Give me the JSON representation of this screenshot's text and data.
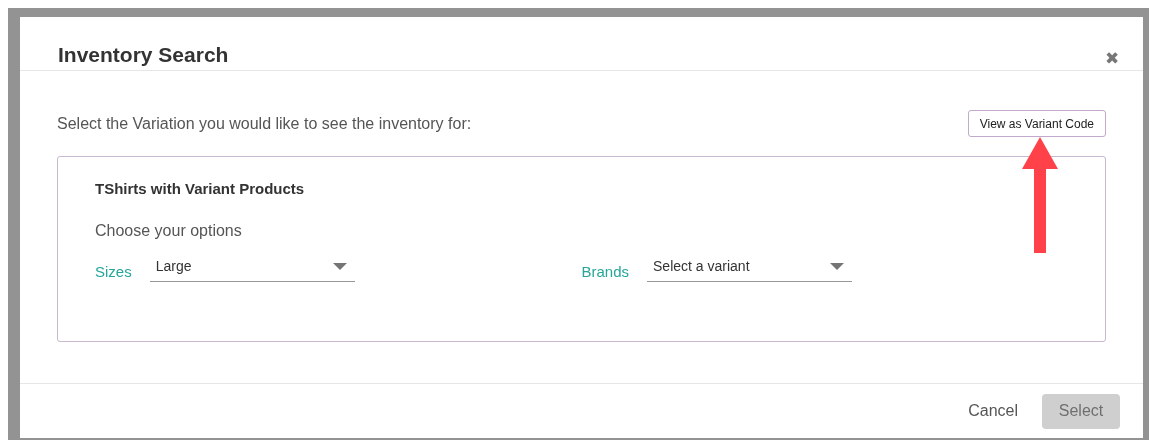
{
  "dialog": {
    "title": "Inventory Search",
    "close": "✖"
  },
  "prompt": "Select the Variation you would like to see the inventory for:",
  "view_button": "View as Variant Code",
  "product": {
    "title": "TShirts with Variant Products",
    "subtitle": "Choose your options",
    "options": [
      {
        "label": "Sizes",
        "value": "Large"
      },
      {
        "label": "Brands",
        "value": "Select a variant"
      }
    ]
  },
  "footer": {
    "buttons": [
      {
        "label": "Cancel",
        "kind": "link",
        "disabled": false
      },
      {
        "label": "Select",
        "kind": "primary",
        "disabled": true
      }
    ]
  }
}
